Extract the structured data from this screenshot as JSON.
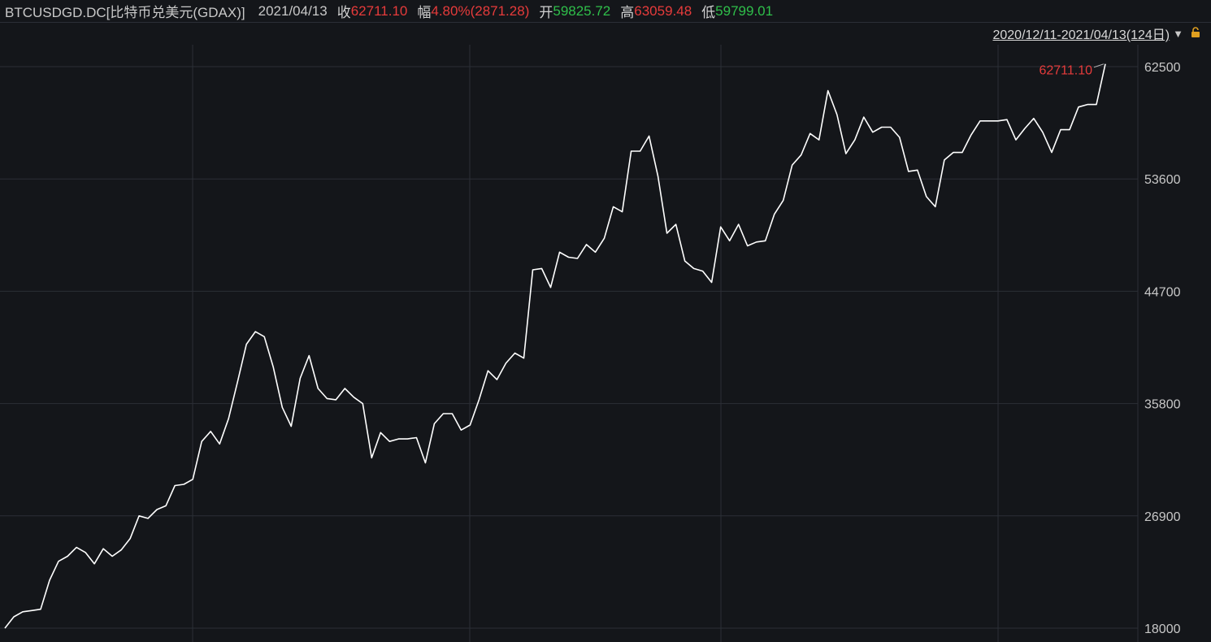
{
  "header": {
    "symbol": "BTCUSDGD.DC[比特币兑美元(GDAX)]",
    "date": "2021/04/13",
    "close_label": "收",
    "close_value": "62711.10",
    "change_label": "幅",
    "change_value": "4.80%(2871.28)",
    "open_label": "开",
    "open_value": "59825.72",
    "high_label": "高",
    "high_value": "63059.48",
    "low_label": "低",
    "low_value": "59799.01"
  },
  "range": {
    "text": "2020/12/11-2021/04/13(124日)",
    "dropdown_icon": "triangle-down-icon",
    "lock_icon": "lock-icon"
  },
  "colors": {
    "background": "#14161a",
    "line": "#ffffff",
    "grid": "#2b2f36",
    "up": "#e63b3b",
    "down": "#2fbf4a"
  },
  "chart_data": {
    "type": "line",
    "ylim": [
      18000,
      62500
    ],
    "yticks": [
      "62500",
      "53600",
      "44700",
      "35800",
      "26900",
      "18000"
    ],
    "grid": true,
    "last_label": "62711.10",
    "series": [
      {
        "values": [
          18000,
          18900,
          19300,
          19400,
          19500,
          21800,
          23300,
          23700,
          24400,
          24000,
          23100,
          24300,
          23700,
          24200,
          25100,
          26900,
          26700,
          27400,
          27700,
          29300,
          29400,
          29800,
          32800,
          33600,
          32600,
          34600,
          37500,
          40500,
          41500,
          41100,
          38700,
          35500,
          34000,
          37800,
          39600,
          37000,
          36200,
          36100,
          37000,
          36300,
          35800,
          31500,
          33500,
          32800,
          33000,
          33000,
          33100,
          31100,
          34200,
          35000,
          35000,
          33700,
          34100,
          36100,
          38400,
          37700,
          39000,
          39800,
          39400,
          46400,
          46500,
          45000,
          47800,
          47400,
          47300,
          48400,
          47800,
          48900,
          51400,
          51000,
          55800,
          55800,
          57000,
          53800,
          49300,
          50000,
          47100,
          46500,
          46300,
          45400,
          49800,
          48700,
          50000,
          48300,
          48600,
          48700,
          50800,
          51900,
          54700,
          55500,
          57200,
          56700,
          60600,
          58700,
          55600,
          56700,
          58500,
          57300,
          57700,
          57700,
          56900,
          54200,
          54300,
          52200,
          51400,
          55100,
          55700,
          55700,
          57100,
          58200,
          58200,
          58200,
          58300,
          56700,
          57600,
          58400,
          57300,
          55700,
          57500,
          57500,
          59300,
          59500,
          59500,
          62711.1
        ]
      }
    ]
  }
}
